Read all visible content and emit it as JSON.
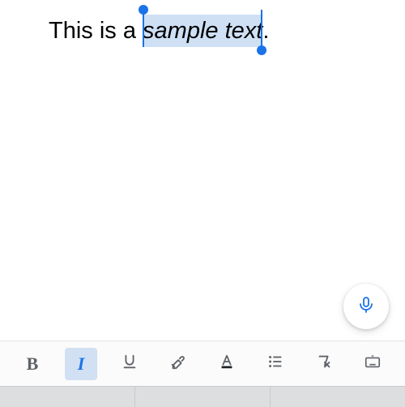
{
  "document": {
    "text_before": "This is a ",
    "selected_text": "sample text",
    "text_after": "."
  },
  "colors": {
    "accent": "#1a73e8",
    "selection_bg": "#cfe0f5",
    "icon": "#5f6368"
  },
  "toolbar": {
    "bold": "B",
    "italic": "I",
    "active_format": "italic"
  }
}
